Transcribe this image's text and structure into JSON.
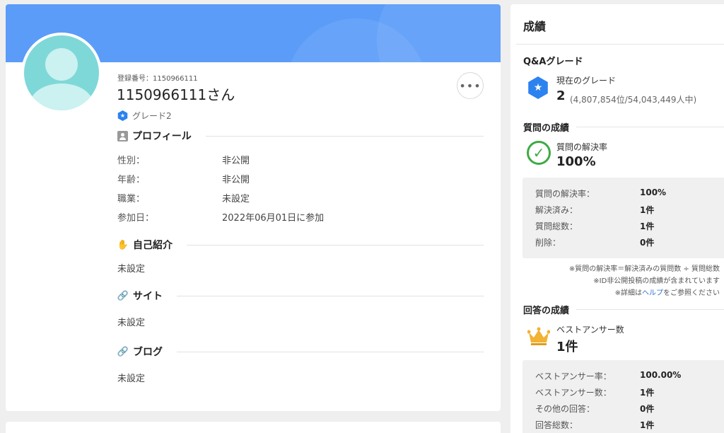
{
  "profile": {
    "registration_no": "登録番号：1150966111",
    "user_name": "1150966111さん",
    "grade": "グレード2",
    "more_label": "•••",
    "profile_heading": "プロフィール",
    "fields": [
      {
        "label": "性別：",
        "value": "非公開"
      },
      {
        "label": "年齢：",
        "value": "非公開"
      },
      {
        "label": "職業：",
        "value": "未設定"
      },
      {
        "label": "参加日：",
        "value": "2022年06月01日に参加"
      }
    ],
    "intro_heading": "自己紹介",
    "intro_value": "未設定",
    "site_heading": "サイト",
    "site_value": "未設定",
    "blog_heading": "ブログ",
    "blog_value": "未設定"
  },
  "sidebar": {
    "title": "成績",
    "qa_grade": {
      "heading": "Q&Aグレード",
      "label": "現在のグレード",
      "value": "2",
      "rank": "(4,807,854位/54,043,449人中)"
    },
    "question_results": {
      "heading": "質問の成績",
      "label": "質問の解決率",
      "value": "100%",
      "stats": [
        {
          "label": "質問の解決率：",
          "value": "100%"
        },
        {
          "label": "解決済み：",
          "value": "1件"
        },
        {
          "label": "質問総数：",
          "value": "1件"
        },
        {
          "label": "削除：",
          "value": "0件"
        }
      ]
    },
    "notes": {
      "line1": "※質問の解決率＝解決済みの質問数 ÷ 質問総数",
      "line2": "※ID非公開投稿の成績が含まれています",
      "line3_pre": "※詳細は",
      "line3_link": "ヘルプ",
      "line3_post": "をご参照ください"
    },
    "answer_results": {
      "heading": "回答の成績",
      "label": "ベストアンサー数",
      "value": "1件",
      "stats": [
        {
          "label": "ベストアンサー率：",
          "value": "100.00%"
        },
        {
          "label": "ベストアンサー数：",
          "value": "1件"
        },
        {
          "label": "その他の回答：",
          "value": "0件"
        },
        {
          "label": "回答総数：",
          "value": "1件"
        }
      ]
    }
  },
  "colors": {
    "banner": "#5b9cf9",
    "grade_blue": "#2c82ef",
    "check_green": "#3cab43",
    "crown_gold": "#f2b233"
  }
}
